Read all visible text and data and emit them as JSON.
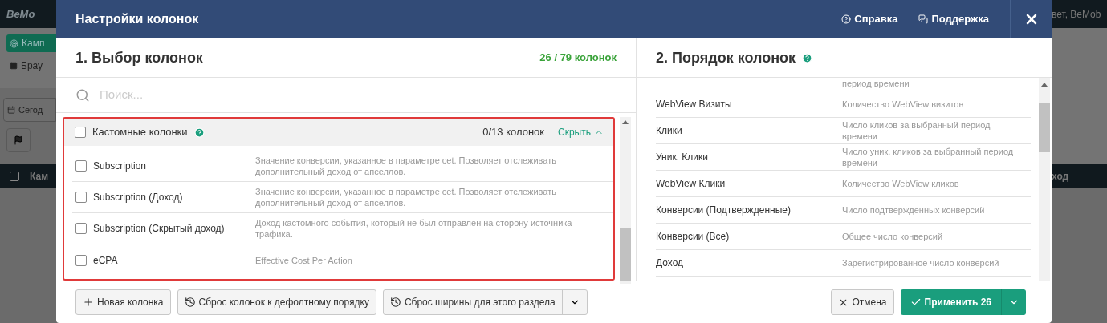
{
  "background": {
    "logo": "BeMo",
    "nav_button": "Камп",
    "tab": "Брау",
    "date_button": "Сегод",
    "table_header_left": "Кам",
    "header_checked": false,
    "account": "вет, BeMob",
    "table_header_right": "ход"
  },
  "modal": {
    "title": "Настройки колонок",
    "links": [
      {
        "kind": "help",
        "label": "Справка"
      },
      {
        "kind": "support",
        "label": "Поддержка"
      }
    ]
  },
  "selection": {
    "title": "1. Выбор колонок",
    "counter": "26 / 79 колонок",
    "search": {
      "placeholder": "Поиск..."
    },
    "group": {
      "label": "Кастомные колонки",
      "checked": false,
      "counter": "0/13 колонок",
      "toggle": "Скрыть",
      "expanded": true,
      "highlighted": true
    },
    "rows": [
      {
        "name": "Subscription",
        "description": "Значение конверсии, указанное в параметре cet. Позволяет отслеживать дополнительный доход от апселлов.",
        "checked": false
      },
      {
        "name": "Subscription (Доход)",
        "description": "Значение конверсии, указанное в параметре cet. Позволяет отслеживать дополнительный доход от апселлов.",
        "checked": false
      },
      {
        "name": "Subscription (Скрытый доход)",
        "description": "Доход кастомного события, который не был отправлен на сторону источника трафика.",
        "checked": false
      },
      {
        "name": "eCPA",
        "description": "Effective Cost Per Action",
        "checked": false
      }
    ]
  },
  "order": {
    "title": "2. Порядок колонок",
    "rows": [
      {
        "description": "период времени"
      },
      {
        "name": "WebView Визиты",
        "description": "Количество WebView визитов"
      },
      {
        "name": "Клики",
        "description": "Число кликов за выбранный период времени"
      },
      {
        "name": "Уник. Клики",
        "description": "Число уник. кликов за выбранный период времени"
      },
      {
        "name": "WebView Клики",
        "description": "Количество WebView кликов"
      },
      {
        "name": "Конверсии (Подтвержденные)",
        "description": "Число подтвержденных конверсий"
      },
      {
        "name": "Конверсии (Все)",
        "description": "Общее число конверсий"
      },
      {
        "name": "Доход",
        "description": "Зарегистрированное число конверсий"
      }
    ]
  },
  "footer": {
    "buttons": [
      {
        "kind": "add",
        "label": "Новая колонка",
        "dropdown": false
      },
      {
        "kind": "reset",
        "label": "Сброс колонок к дефолтному порядку",
        "dropdown": false
      },
      {
        "kind": "reset",
        "label": "Сброс ширины для этого раздела",
        "dropdown": true
      }
    ],
    "cancel": "Отмена",
    "apply": "Применить 26"
  }
}
